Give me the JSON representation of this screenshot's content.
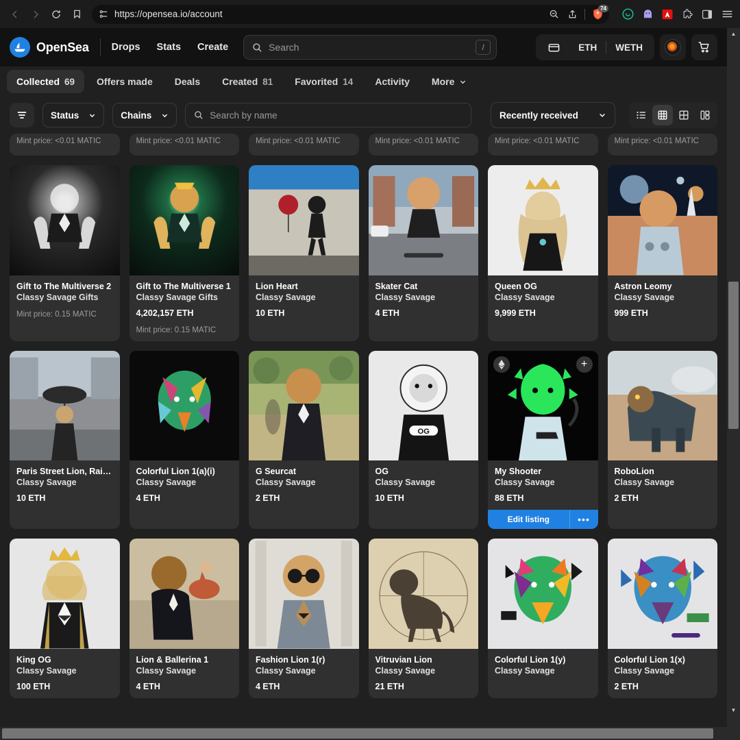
{
  "browser": {
    "url": "https://opensea.io/account",
    "back_icon": "back-arrow-icon",
    "forward_icon": "forward-arrow-icon",
    "reload_icon": "reload-icon",
    "bookmark_icon": "bookmark-icon",
    "site_settings_icon": "site-settings-icon",
    "zoom_out_icon": "zoom-out-icon",
    "share_icon": "share-icon",
    "shield_badge_count": "74",
    "extensions": [
      "wallet-extension-icon",
      "ghost-extension-icon",
      "adobe-pdf-extension-icon",
      "extensions-puzzle-icon",
      "sidebar-toggle-icon",
      "browser-menu-icon"
    ]
  },
  "header": {
    "brand": "OpenSea",
    "nav": [
      {
        "label": "Drops"
      },
      {
        "label": "Stats"
      },
      {
        "label": "Create"
      }
    ],
    "search_placeholder": "Search",
    "search_shortcut": "/",
    "wallet_icon": "wallet-icon",
    "currencies": [
      "ETH",
      "WETH"
    ],
    "profile_icon": "profile-avatar",
    "cart_icon": "cart-icon"
  },
  "tabs": [
    {
      "label": "Collected",
      "count": "69",
      "active": true
    },
    {
      "label": "Offers made",
      "count": "",
      "active": false
    },
    {
      "label": "Deals",
      "count": "",
      "active": false
    },
    {
      "label": "Created",
      "count": "81",
      "active": false
    },
    {
      "label": "Favorited",
      "count": "14",
      "active": false
    },
    {
      "label": "Activity",
      "count": "",
      "active": false
    },
    {
      "label": "More",
      "count": "",
      "active": false,
      "chevron": true
    }
  ],
  "filters": {
    "filter_icon": "filter-icon",
    "status_label": "Status",
    "chains_label": "Chains",
    "name_search_placeholder": "Search by name",
    "sort_label": "Recently received",
    "views": [
      {
        "name": "list-view",
        "active": false
      },
      {
        "name": "grid-small-view",
        "active": true
      },
      {
        "name": "grid-large-view",
        "active": false
      },
      {
        "name": "gallery-view",
        "active": false
      }
    ]
  },
  "grid": {
    "partial_row": [
      {
        "mint": "Mint price: <0.01 MATIC"
      },
      {
        "mint": "Mint price: <0.01 MATIC"
      },
      {
        "mint": "Mint price: <0.01 MATIC"
      },
      {
        "mint": "Mint price: <0.01 MATIC"
      },
      {
        "mint": "Mint price: <0.01 MATIC"
      },
      {
        "mint": "Mint price: <0.01 MATIC"
      }
    ],
    "items": [
      {
        "title": "Gift to The Multiverse 2",
        "collection": "Classy Savage Gifts",
        "price": "",
        "mint": "Mint price: 0.15 MATIC",
        "art": "lion-hands-bw"
      },
      {
        "title": "Gift to The Multiverse 1",
        "collection": "Classy Savage Gifts",
        "price": "4,202,157 ETH",
        "mint": "Mint price: 0.15 MATIC",
        "art": "lion-hands-green"
      },
      {
        "title": "Lion Heart",
        "collection": "Classy Savage",
        "price": "10 ETH",
        "mint": "",
        "art": "lion-balloon-mural"
      },
      {
        "title": "Skater Cat",
        "collection": "Classy Savage",
        "price": "4 ETH",
        "mint": "",
        "art": "lion-skateboard-street"
      },
      {
        "title": "Queen OG",
        "collection": "Classy Savage",
        "price": "9,999 ETH",
        "mint": "",
        "art": "lioness-crown-white"
      },
      {
        "title": "Astron Leomy",
        "collection": "Classy Savage",
        "price": "999 ETH",
        "mint": "",
        "art": "lion-astronaut-mars"
      },
      {
        "title": "Paris Street Lion, Rainy ...",
        "collection": "Classy Savage",
        "price": "10 ETH",
        "mint": "",
        "art": "lion-paris-rain"
      },
      {
        "title": "Colorful Lion 1(a)(i)",
        "collection": "Classy Savage",
        "price": "4 ETH",
        "mint": "",
        "art": "lion-colorful-dark"
      },
      {
        "title": "G Seurcat",
        "collection": "Classy Savage",
        "price": "2 ETH",
        "mint": "",
        "art": "lion-seurat-park"
      },
      {
        "title": "OG",
        "collection": "Classy Savage",
        "price": "10 ETH",
        "mint": "",
        "art": "lion-og-chain-bw"
      },
      {
        "title": "My Shooter",
        "collection": "Classy Savage",
        "price": "88 ETH",
        "mint": "",
        "art": "lion-green-neon-gun",
        "eth_badge": true,
        "add_badge": true,
        "edit_label": "Edit listing",
        "more_label": "•••"
      },
      {
        "title": "RoboLion",
        "collection": "Classy Savage",
        "price": "2 ETH",
        "mint": "",
        "art": "lion-robot-desert"
      },
      {
        "title": "King OG",
        "collection": "Classy Savage",
        "price": "100 ETH",
        "mint": "",
        "art": "lion-king-tuxedo-crown"
      },
      {
        "title": "Lion & Ballerina 1",
        "collection": "Classy Savage",
        "price": "4 ETH",
        "mint": "",
        "art": "lion-ballerina-degas"
      },
      {
        "title": "Fashion Lion 1(r)",
        "collection": "Classy Savage",
        "price": "4 ETH",
        "mint": "",
        "art": "lion-fashion-glasses-suit"
      },
      {
        "title": "Vitruvian Lion",
        "collection": "Classy Savage",
        "price": "21 ETH",
        "mint": "",
        "art": "lion-vitruvian-sketch"
      },
      {
        "title": "Colorful Lion 1(y)",
        "collection": "Classy Savage",
        "price": "",
        "mint": "",
        "art": "lion-colorful-geometric-y"
      },
      {
        "title": "Colorful Lion 1(x)",
        "collection": "Classy Savage",
        "price": "2 ETH",
        "mint": "",
        "art": "lion-colorful-geometric-x"
      }
    ]
  },
  "colors": {
    "page_bg": "#202020",
    "card_bg": "#303030",
    "header_bg": "#121212",
    "accent_blue": "#2081e2",
    "brave_orange": "#fb542b"
  }
}
